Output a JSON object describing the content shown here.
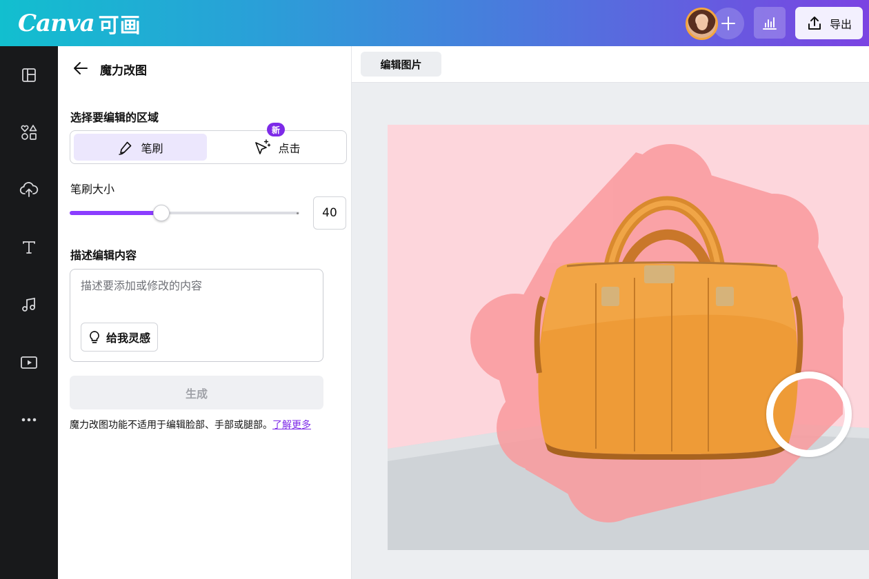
{
  "header": {
    "logo_latin": "Canva",
    "logo_cn": "可画",
    "export_label": "导出",
    "icons": {
      "add": "plus-icon",
      "insights": "bar-chart-icon",
      "export": "upload-icon"
    },
    "colors": {
      "gradient_start": "#12bfcf",
      "gradient_end": "#7b43e2"
    }
  },
  "rail": {
    "items": [
      {
        "icon": "design-layout-icon"
      },
      {
        "icon": "elements-icon"
      },
      {
        "icon": "upload-cloud-icon"
      },
      {
        "icon": "text-icon"
      },
      {
        "icon": "music-icon"
      },
      {
        "icon": "video-icon"
      },
      {
        "icon": "more-icon"
      }
    ]
  },
  "panel": {
    "title": "魔力改图",
    "area_label": "选择要编辑的区域",
    "mode_brush": "笔刷",
    "mode_click": "点击",
    "new_badge": "新",
    "brush_size_label": "笔刷大小",
    "brush_size_value": "40",
    "brush_size_fraction": 0.4,
    "describe_label": "描述编辑内容",
    "describe_placeholder": "描述要添加或修改的内容",
    "inspire_label": "给我灵感",
    "generate_label": "生成",
    "disclaimer": "魔力改图功能不适用于编辑脸部、手部或腿部。",
    "learn_more": "了解更多",
    "colors": {
      "accent": "#8b3dff",
      "badge": "#7d2ae8",
      "selected_bg": "#ece7fd"
    }
  },
  "canvas": {
    "edit_image_label": "编辑图片",
    "colors": {
      "backdrop": "#fdd6dc",
      "brush_mask": "#fa9a9d",
      "floor": "#cfd3d7",
      "bag": "#ee9b37"
    }
  }
}
